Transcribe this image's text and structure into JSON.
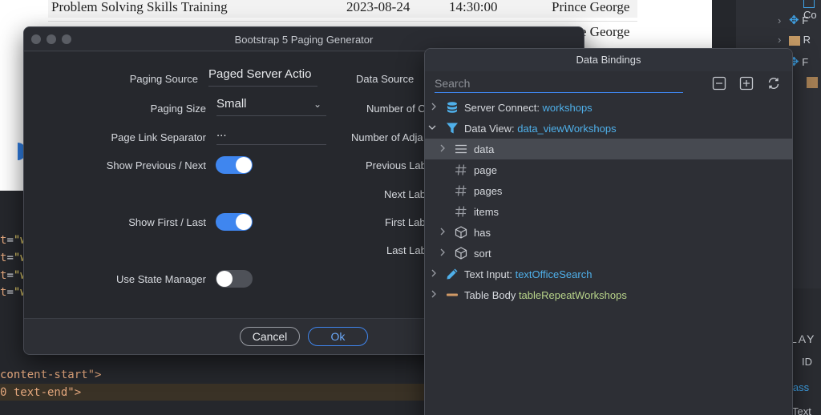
{
  "background_page": {
    "rows": [
      {
        "title": "Problem Solving Skills Training",
        "date": "2023-08-24",
        "time": "14:30:00",
        "city": "Prince George"
      },
      {
        "title": "",
        "date": "",
        "time": "",
        "city": "Prince George"
      }
    ]
  },
  "code_editor": {
    "lines": [
      {
        "attr": "t",
        "op": "=",
        "str": "\"w"
      },
      {
        "attr": "t",
        "op": "=",
        "str": "\"w"
      },
      {
        "attr": "t",
        "op": "=",
        "str": "\"w"
      },
      {
        "attr": "t",
        "op": "=",
        "str": "\"w"
      }
    ],
    "line_content_start": "content-start\">",
    "line_text_end": "0 text-end\">"
  },
  "right_panel": {
    "tree_top_label": "Co",
    "tree_items": [
      "F",
      "R",
      "F"
    ],
    "props_heading": "LAY",
    "props_id": "ID",
    "props_class": "lass",
    "props_text": "Text"
  },
  "pager_dialog": {
    "title": "Bootstrap 5 Paging Generator",
    "fields": {
      "paging_source_label": "Paging Source",
      "paging_source_value": "Paged Server Actio",
      "paging_size_label": "Paging Size",
      "paging_size_value": "Small",
      "separator_label": "Page Link Separator",
      "separator_value": "...",
      "show_prev_next_label": "Show Previous / Next",
      "show_first_last_label": "Show First / Last",
      "use_state_label": "Use State Manager"
    },
    "toggles": {
      "show_prev_next": true,
      "show_first_last": true,
      "use_state_manager": false
    },
    "right_labels": {
      "data_source": "Data Source",
      "number_of": "Number of C",
      "number_adj": "Number of Adja",
      "previous": "Previous Lab",
      "next": "Next Lab",
      "first": "First Lab",
      "last": "Last Lab"
    },
    "buttons": {
      "cancel": "Cancel",
      "ok": "Ok"
    }
  },
  "bindings_panel": {
    "title": "Data Bindings",
    "search_placeholder": "Search",
    "tree": [
      {
        "label": "Server Connect: ",
        "link": "workshops",
        "icon": "database-icon"
      },
      {
        "label": "Data View: ",
        "link": "data_viewWorkshops",
        "icon": "filter-icon"
      },
      {
        "label": "data",
        "icon": "list-icon"
      },
      {
        "label": "page",
        "icon": "hash-icon"
      },
      {
        "label": "pages",
        "icon": "hash-icon"
      },
      {
        "label": "items",
        "icon": "hash-icon"
      },
      {
        "label": "has",
        "icon": "cube-icon"
      },
      {
        "label": "sort",
        "icon": "cube-icon"
      },
      {
        "label": "Text Input: ",
        "link": "textOfficeSearch",
        "icon": "pencil-icon"
      },
      {
        "label": "Table Body ",
        "link": "tableRepeatWorkshops",
        "icon": "dash-icon"
      }
    ]
  }
}
